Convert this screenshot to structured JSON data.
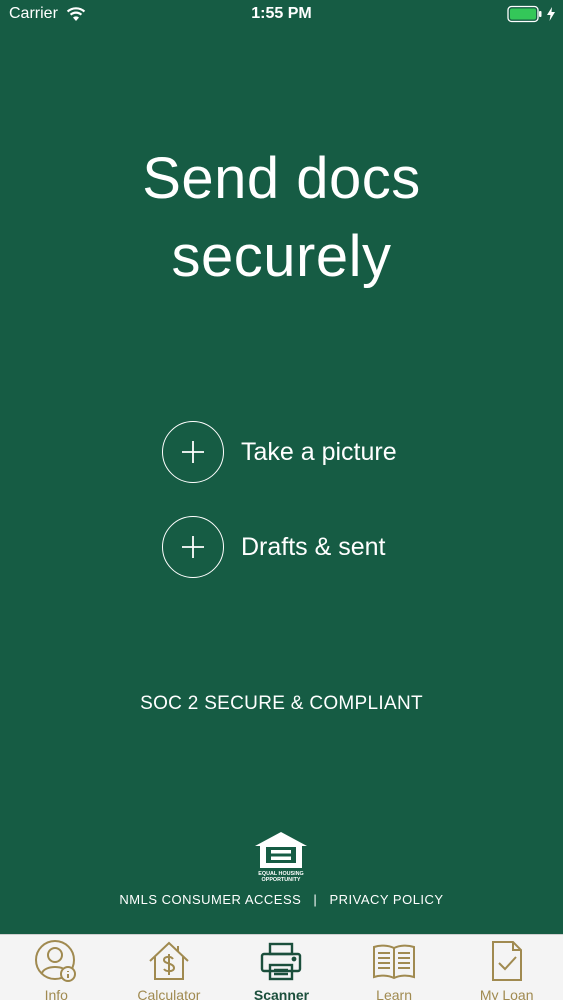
{
  "status_bar": {
    "carrier": "Carrier",
    "time": "1:55 PM"
  },
  "headline": {
    "line1": "Send docs",
    "line2": "securely"
  },
  "actions": [
    {
      "label": "Take a picture",
      "icon": "plus-circle-icon"
    },
    {
      "label": "Drafts & sent",
      "icon": "plus-circle-icon"
    }
  ],
  "soc_text": "SOC 2 SECURE & COMPLIANT",
  "ehl_logo_text": "EQUAL HOUSING OPPORTUNITY",
  "footer": {
    "nmls": "NMLS CONSUMER ACCESS",
    "separator": "|",
    "privacy": "PRIVACY POLICY"
  },
  "tabs": [
    {
      "label": "Info",
      "icon": "person-info-icon"
    },
    {
      "label": "Calculator",
      "icon": "house-dollar-icon"
    },
    {
      "label": "Scanner",
      "icon": "printer-icon",
      "active": true
    },
    {
      "label": "Learn",
      "icon": "book-icon"
    },
    {
      "label": "My Loan",
      "icon": "document-check-icon"
    }
  ],
  "colors": {
    "background": "#165c44",
    "tab_bar": "#f4f4f4",
    "tab_inactive": "#a08a50",
    "tab_active": "#1b4f3c",
    "battery": "#34c759"
  }
}
